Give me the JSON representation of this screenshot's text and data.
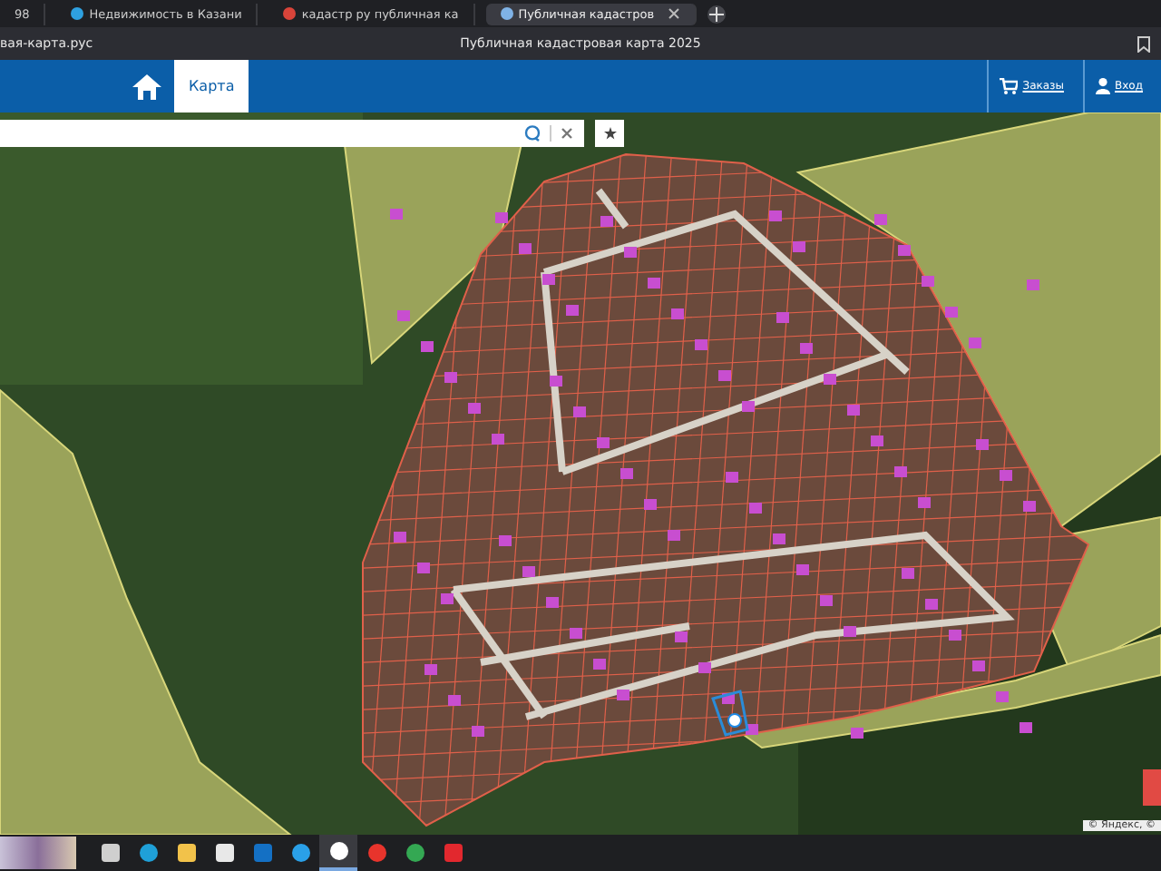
{
  "browser": {
    "tabs": [
      {
        "title": "98",
        "kind": "plain",
        "selected": false
      },
      {
        "title": "Недвижимость в Казани",
        "kind": "colorful",
        "selected": false
      },
      {
        "title": "кадастр ру публичная ка",
        "kind": "red",
        "selected": false
      },
      {
        "title": "Публичная кадастров",
        "kind": "blue",
        "selected": true
      }
    ],
    "address": "вая-карта.рус",
    "page_title": "Публичная кадастровая карта 2025"
  },
  "header": {
    "nav": [
      {
        "label": "Карта",
        "selected": true
      }
    ],
    "actions": [
      {
        "label": "Заказы",
        "kind": "cart"
      },
      {
        "label": "Вход",
        "kind": "user"
      }
    ]
  },
  "map": {
    "attribution": "© Яндекс, ©"
  },
  "taskbar": {
    "apps": [
      {
        "kind": "taskview",
        "selected": false
      },
      {
        "kind": "edge",
        "selected": false
      },
      {
        "kind": "folder",
        "selected": false
      },
      {
        "kind": "store",
        "selected": false
      },
      {
        "kind": "mail",
        "selected": false
      },
      {
        "kind": "ring",
        "selected": false
      },
      {
        "kind": "yabrowser",
        "selected": true
      },
      {
        "kind": "yandex",
        "selected": false
      },
      {
        "kind": "chrome",
        "selected": false
      },
      {
        "kind": "wps",
        "selected": false
      }
    ]
  }
}
